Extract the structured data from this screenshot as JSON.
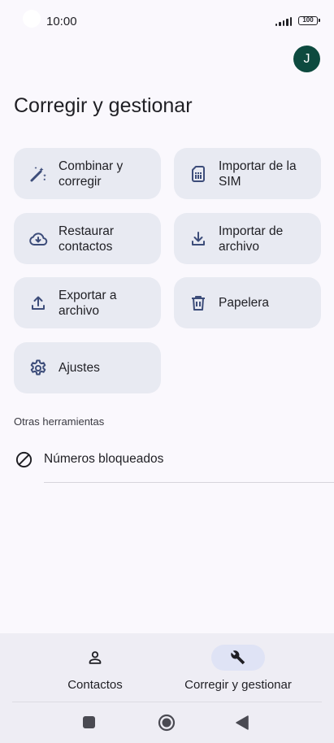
{
  "status_bar": {
    "time": "10:00",
    "battery": "100"
  },
  "account": {
    "avatar_letter": "J",
    "avatar_color": "#0d4a3f"
  },
  "page": {
    "title": "Corregir y gestionar"
  },
  "tiles": [
    {
      "id": "merge",
      "line1": "Combinar y",
      "line2": "corregir",
      "icon": "magic-wand-icon"
    },
    {
      "id": "import-sim",
      "line1": "Importar de la",
      "line2": "SIM",
      "icon": "sim-card-icon"
    },
    {
      "id": "restore",
      "line1": "Restaurar",
      "line2": "contactos",
      "icon": "cloud-download-icon"
    },
    {
      "id": "import-file",
      "line1": "Importar de",
      "line2": "archivo",
      "icon": "download-icon"
    },
    {
      "id": "export-file",
      "line1": "Exportar a",
      "line2": "archivo",
      "icon": "upload-icon"
    },
    {
      "id": "trash",
      "line1": "Papelera",
      "line2": "",
      "icon": "trash-icon"
    },
    {
      "id": "settings",
      "line1": "Ajustes",
      "line2": "",
      "icon": "gear-icon"
    }
  ],
  "other_tools": {
    "label": "Otras herramientas",
    "items": [
      {
        "label": "Números bloqueados",
        "icon": "block-icon"
      }
    ]
  },
  "bottom_nav": {
    "items": [
      {
        "label": "Contactos",
        "icon": "person-icon",
        "active": false
      },
      {
        "label": "Corregir y gestionar",
        "icon": "wrench-icon",
        "active": true
      }
    ]
  },
  "system_nav": [
    "recent-apps-icon",
    "home-icon",
    "back-icon"
  ],
  "colors": {
    "tile_bg": "#e8eaf2",
    "icon_color": "#3d4d7a",
    "active_pill": "#dfe3f5"
  }
}
